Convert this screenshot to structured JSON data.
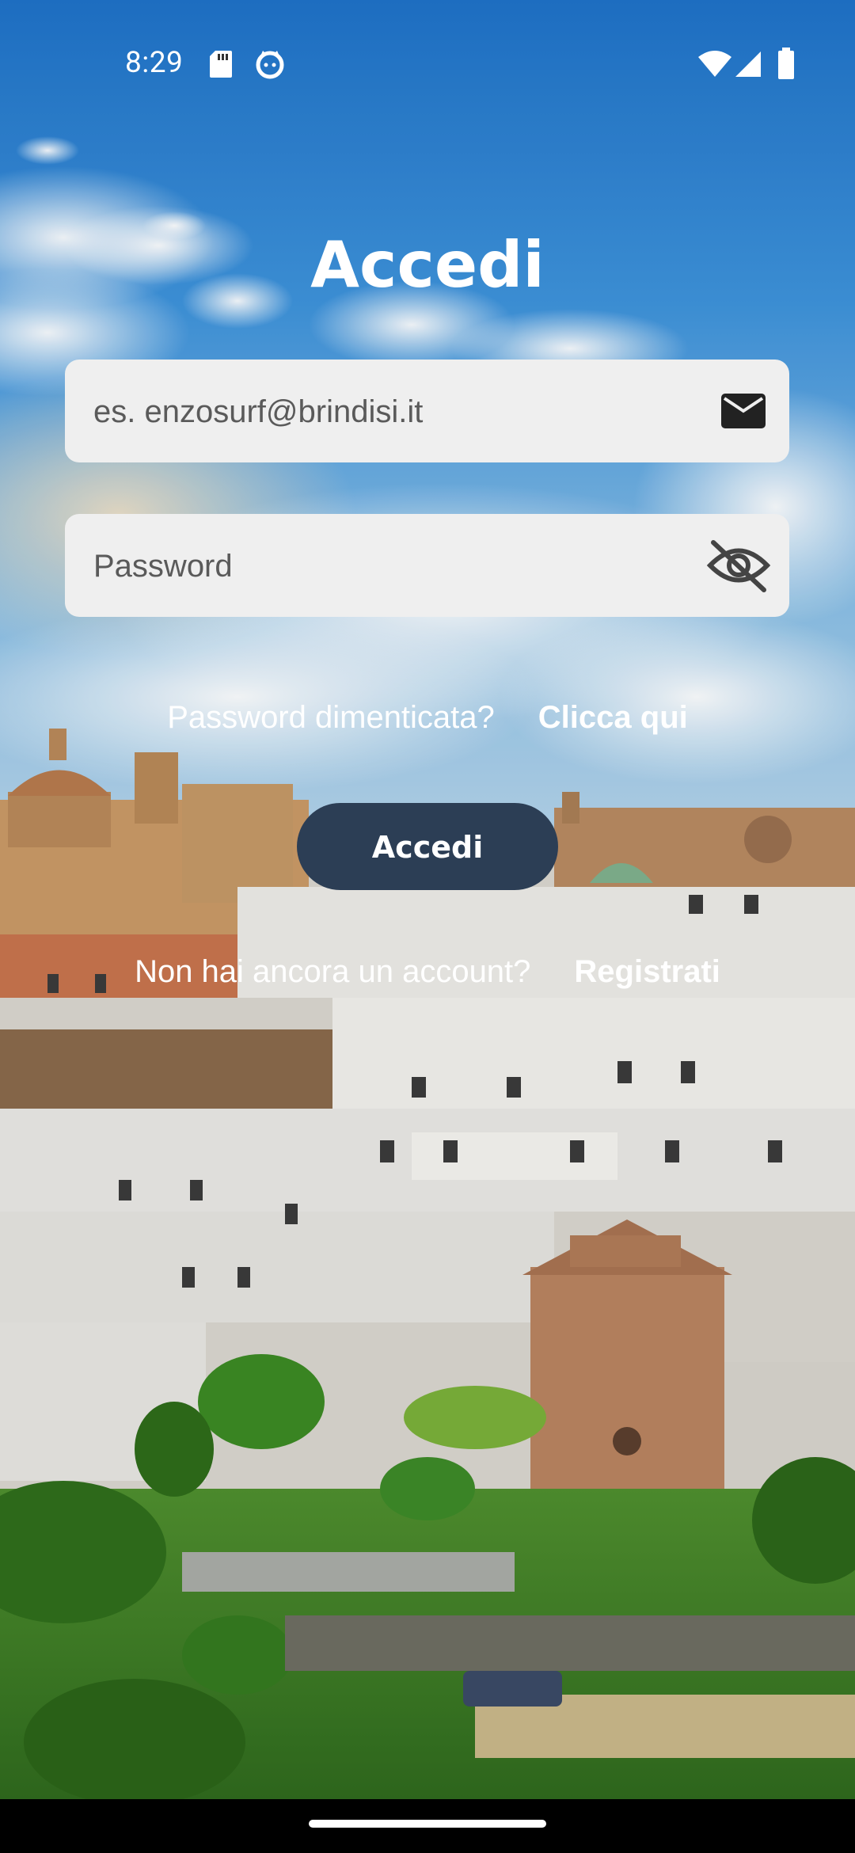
{
  "status_bar": {
    "time": "8:29",
    "icons": [
      "sd-card-icon",
      "cat-face-icon",
      "wifi-icon",
      "cellular-signal-icon",
      "battery-icon"
    ]
  },
  "login": {
    "title": "Accedi",
    "email_placeholder": "es. enzosurf@brindisi.it",
    "email_icon": "mail-icon",
    "password_placeholder": "Password",
    "password_icon": "eye-off-icon",
    "forgot_text": "Password dimenticata?",
    "forgot_link": "Clicca qui",
    "submit_label": "Accedi",
    "signup_text": "Non hai ancora un account?",
    "signup_link": "Registrati"
  },
  "colors": {
    "button_bg": "#2c3e55",
    "field_bg": "#efefef",
    "text": "#ffffff"
  }
}
